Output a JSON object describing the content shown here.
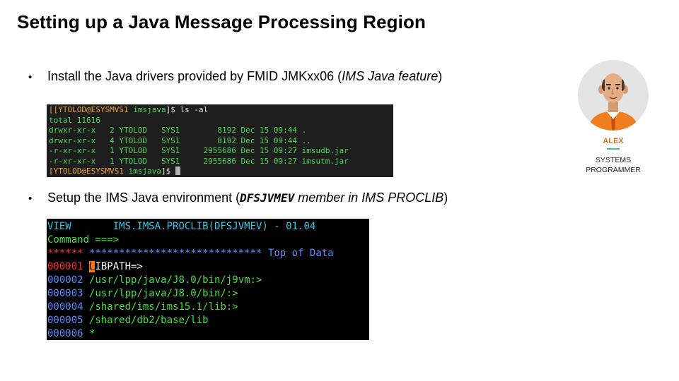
{
  "slide": {
    "title": "Setting up a Java Message Processing Region"
  },
  "bullets": [
    {
      "marker": "•",
      "text_prefix": "Install the Java drivers provided by FMID JMKxx06 (",
      "text_italic": "IMS Java feature",
      "text_suffix": ")"
    },
    {
      "marker": "•",
      "text_prefix": "Setup the IMS Java environment (",
      "text_code": "DFSJVMEV",
      "text_italic": " member in IMS PROCLIB",
      "text_suffix": ")"
    }
  ],
  "terminal": {
    "prompt_open": "[[",
    "prompt_user_host": "YTOLOD@ESYSMVS1",
    "prompt_dir": "imsjava",
    "prompt_close": "]$ ",
    "command": "ls -al",
    "total_line": "total 11616",
    "listing": [
      "drwxr-xr-x   2 YTOLOD   SYS1        8192 Dec 15 09:44 .",
      "drwxr-xr-x   4 YTOLOD   SYS1        8192 Dec 15 09:44 ..",
      "-r-xr-xr-x   1 YTOLOD   SYS1     2955686 Dec 15 09:27 imsudb.jar",
      "-r-xr-xr-x   1 YTOLOD   SYS1     2955686 Dec 15 09:27 imsutm.jar"
    ],
    "final_prompt_open": "[",
    "final_prompt_user_host": "YTOLOD@ESYSMVS1",
    "final_prompt_dir": "imsjava",
    "final_prompt_close": "]$ "
  },
  "ispf": {
    "header_mode": "VIEW",
    "header_dataset": "IMS.IMSA.PROCLIB(DFSJVMEV) - 01.04",
    "command_label": "Command ===>",
    "top_marker": "******",
    "top_stars": "*****************************",
    "top_text": "Top of Data",
    "lines": [
      {
        "num": "000001",
        "text": "LIBPATH=>",
        "cursor_char": "L",
        "num_color": "#ff2b2b",
        "text_color": "#ffffff"
      },
      {
        "num": "000002",
        "text": "/usr/lpp/java/J8.0/bin/j9vm:>",
        "num_color": "#5a8cff",
        "text_color": "#43e043"
      },
      {
        "num": "000003",
        "text": "/usr/lpp/java/J8.0/bin/:>",
        "num_color": "#5a8cff",
        "text_color": "#43e043"
      },
      {
        "num": "000004",
        "text": "/shared/ims/ims15.1/lib:>",
        "num_color": "#5a8cff",
        "text_color": "#43e043"
      },
      {
        "num": "000005",
        "text": "/shared/db2/base/lib",
        "num_color": "#5a8cff",
        "text_color": "#43e043"
      },
      {
        "num": "000006",
        "text": "*",
        "num_color": "#5a8cff",
        "text_color": "#43e043"
      }
    ]
  },
  "persona": {
    "name": "ALEX",
    "role_line1": "SYSTEMS",
    "role_line2": "PROGRAMMER",
    "icon": "avatar-bald-man-orange-shirt",
    "name_color": "#e8701a",
    "accent_color": "#3cc48c"
  }
}
